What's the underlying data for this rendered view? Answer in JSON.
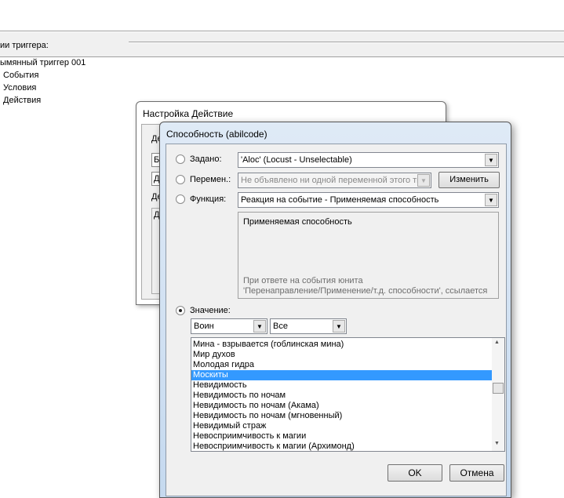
{
  "background": {
    "section_label": "ии триггера:",
    "tree": [
      "ымянный триггер 001",
      "События",
      "Условия",
      "Действия"
    ]
  },
  "back_dialog": {
    "title": "Настройка Действие",
    "fragments": [
      "Де",
      "Бе",
      "Д",
      "Де",
      "Д"
    ]
  },
  "dialog": {
    "title": "Способность (abilcode)",
    "preset": {
      "label": "Задано:",
      "value": "'Aloc' (Locust - Unselectable)"
    },
    "variable": {
      "label": "Перемен.:",
      "value": "Не объявлено ни одной переменной этого ти",
      "button": "Изменить"
    },
    "function": {
      "label": "Функция:",
      "value": "Реакция на событие - Применяемая способность"
    },
    "description": {
      "title": "Применяемая способность",
      "hint_1": "При ответе на события юнита",
      "hint_2": "'Перенаправление/Применение/т.д. способности', ссылается"
    },
    "value": {
      "label": "Значение:",
      "race": "Воин",
      "filter": "Все"
    },
    "selected_radio": "value",
    "list": [
      "Мина - взрывается (гоблинская мина)",
      "Мир духов",
      "Молодая гидра",
      "Москиты",
      "Невидимость",
      "Невидимость по ночам",
      "Невидимость по ночам (Акама)",
      "Невидимость по ночам (мгновенный)",
      "Невидимый страж",
      "Невосприимчивость к магии",
      "Невосприимчивость к магии (Архимонд)"
    ],
    "selected_item": "Москиты",
    "ok": "OK",
    "cancel": "Отмена"
  }
}
